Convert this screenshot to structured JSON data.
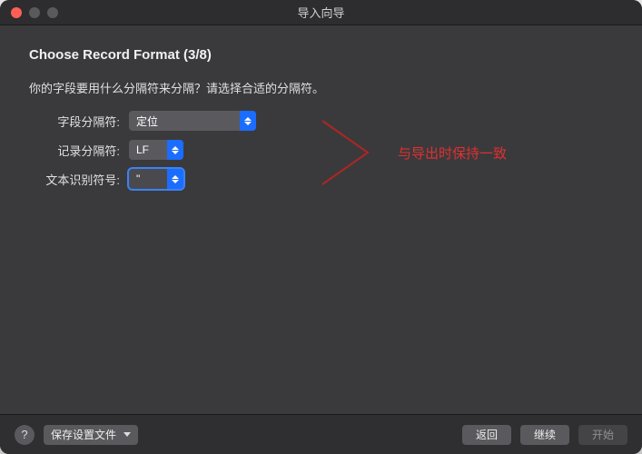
{
  "window": {
    "title": "导入向导"
  },
  "page": {
    "title": "Choose Record Format (3/8)",
    "instruction": "你的字段要用什么分隔符来分隔？请选择合适的分隔符。"
  },
  "form": {
    "field_separator": {
      "label": "字段分隔符:",
      "value": "定位"
    },
    "record_separator": {
      "label": "记录分隔符:",
      "value": "LF"
    },
    "text_qualifier": {
      "label": "文本识别符号:",
      "value": "\""
    }
  },
  "annotation": {
    "text": "与导出时保持一致"
  },
  "footer": {
    "help": "?",
    "save_settings": "保存设置文件",
    "back": "返回",
    "continue": "继续",
    "start": "开始"
  }
}
